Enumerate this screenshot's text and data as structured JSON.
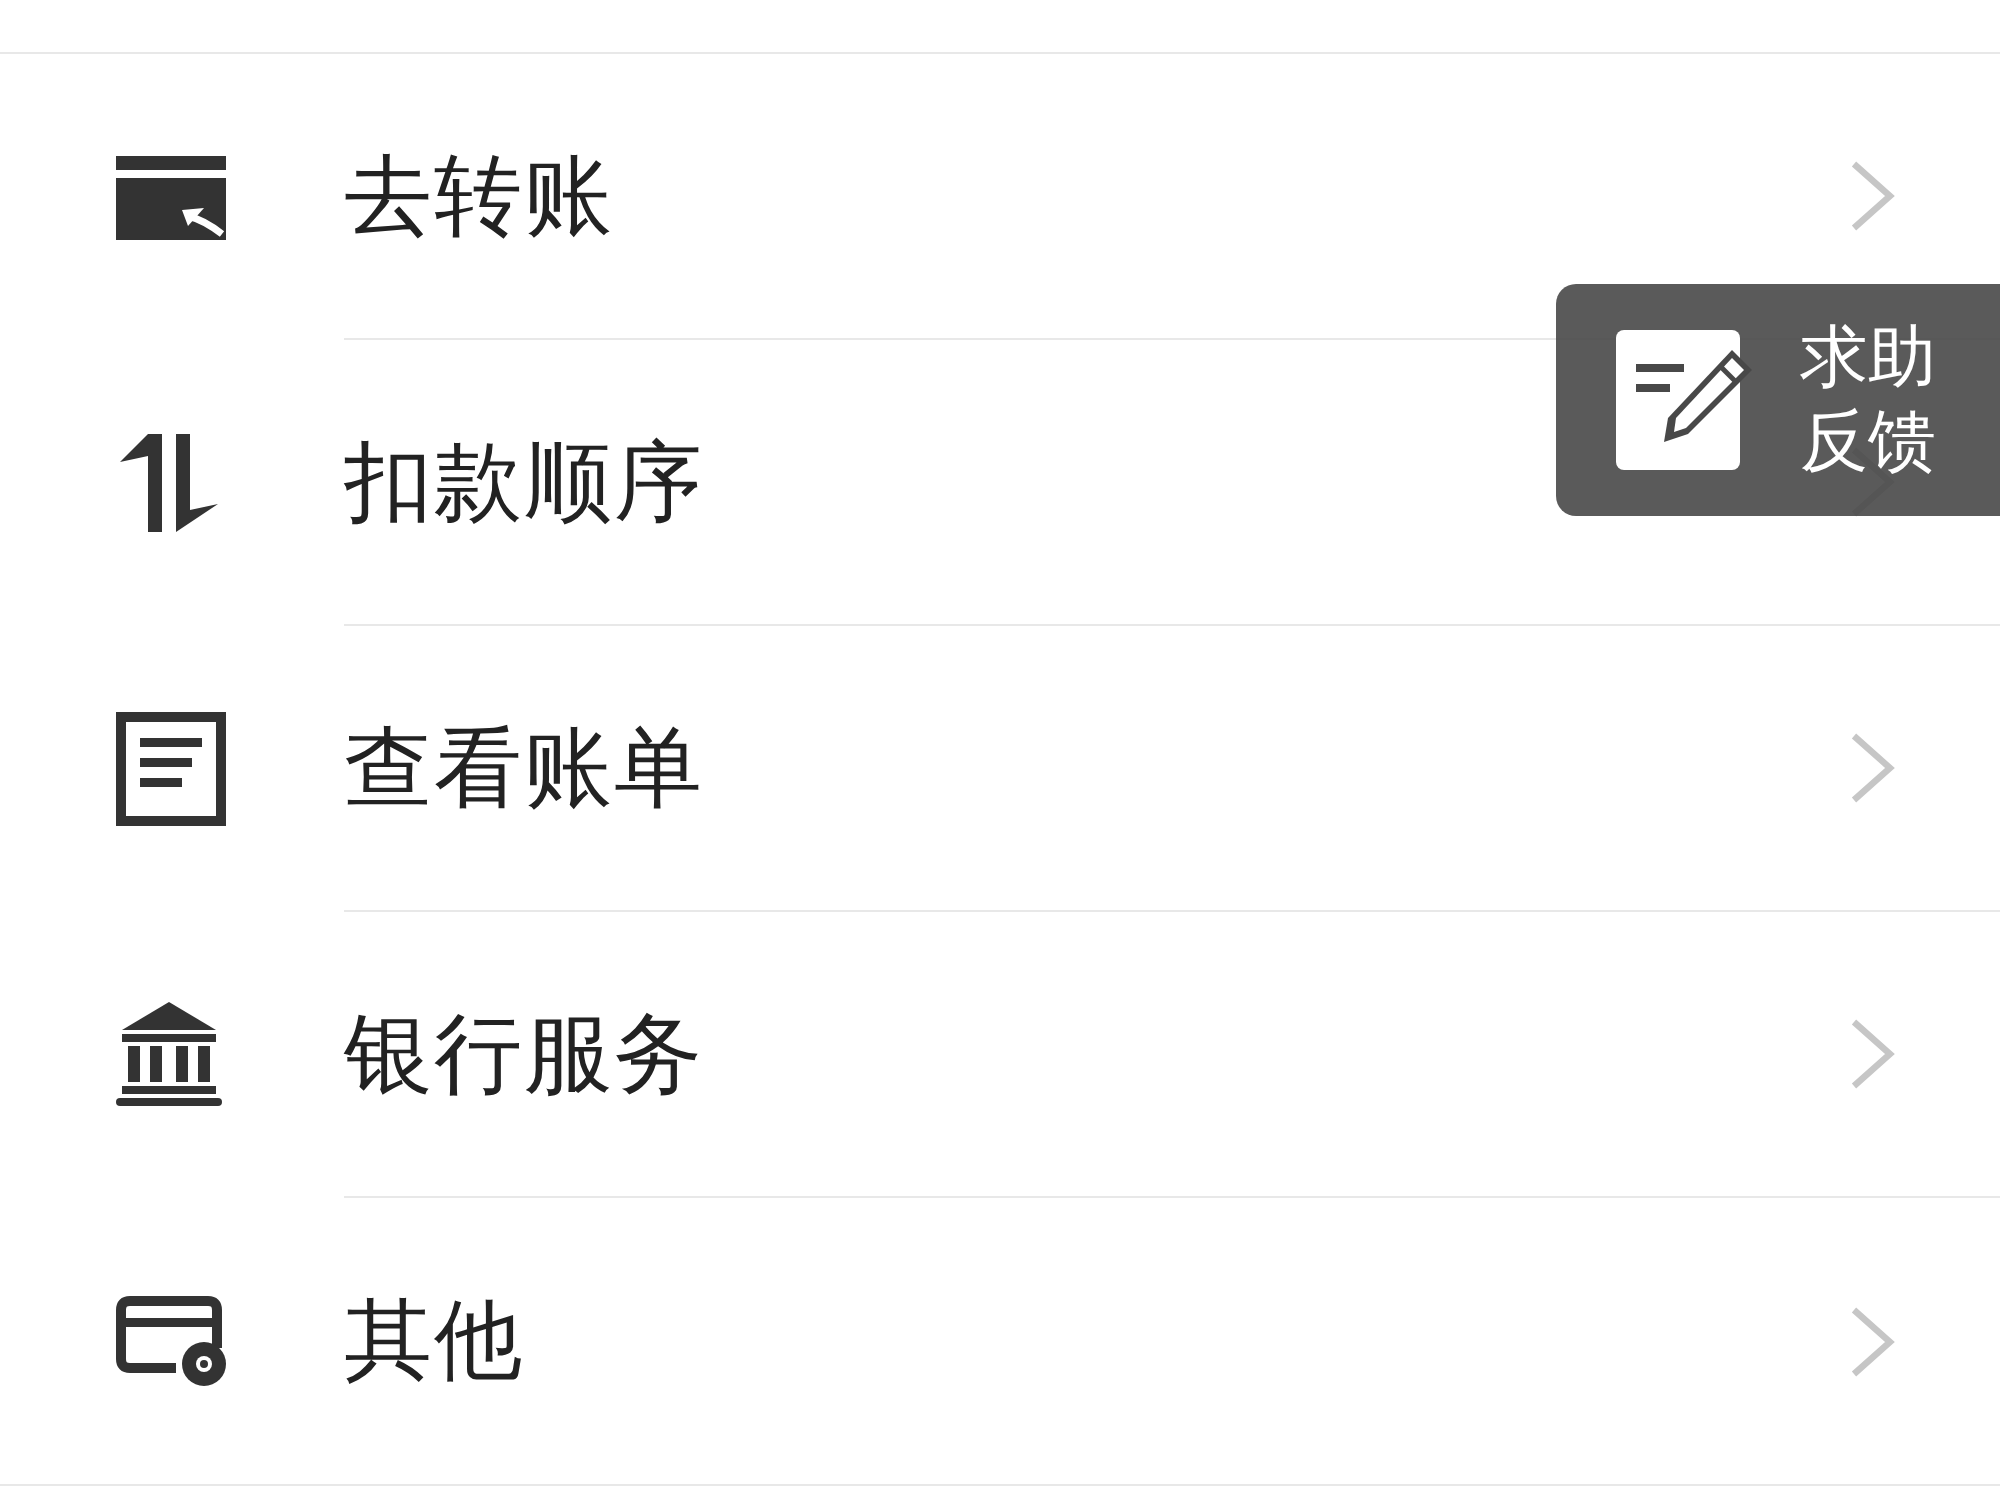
{
  "menu": [
    {
      "label": "去转账"
    },
    {
      "label": "扣款顺序"
    },
    {
      "label": "查看账单"
    },
    {
      "label": "银行服务"
    },
    {
      "label": "其他"
    }
  ],
  "feedback_button": {
    "label": "求助反馈"
  }
}
